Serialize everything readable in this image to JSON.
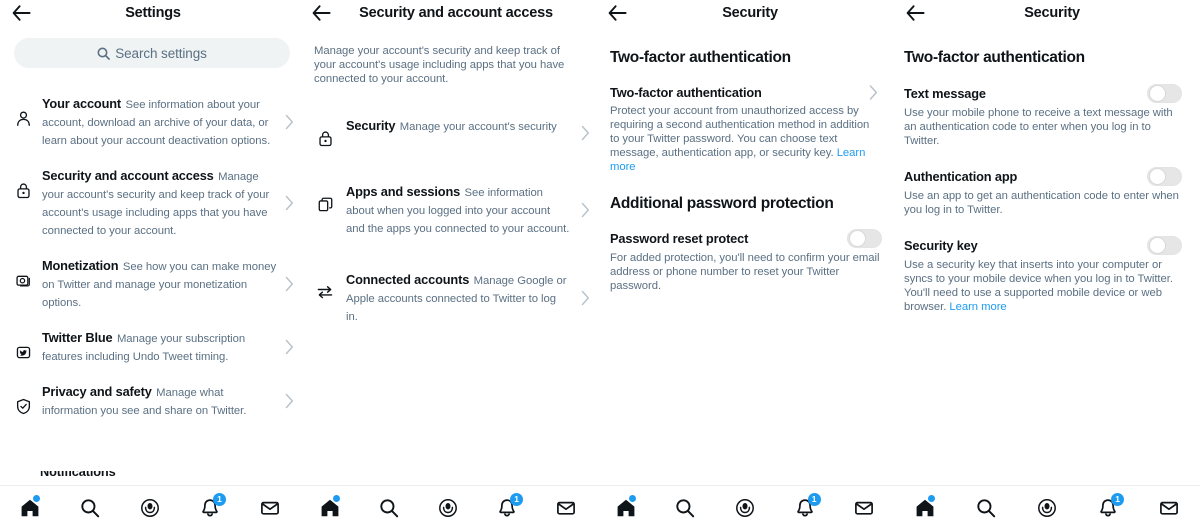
{
  "theme": {
    "accent": "#1d9bf0",
    "text": "#0f1419",
    "muted": "#5b7083",
    "search_bg": "#eff3f4"
  },
  "panels": [
    {
      "id": "settings",
      "title": "Settings",
      "back_icon": "arrow-left-icon",
      "search": {
        "placeholder": "Search settings",
        "icon": "search-icon"
      },
      "rows": [
        {
          "icon": "person-icon",
          "title": "Your account",
          "desc": "See information about your account, download an archive of your data, or learn about your account deactivation options."
        },
        {
          "icon": "lock-icon",
          "title": "Security and account access",
          "desc": "Manage your account's security and keep track of your account's usage including apps that you have connected to your account."
        },
        {
          "icon": "monetization-icon",
          "title": "Monetization",
          "desc": "See how you can make money on Twitter and manage your monetization options."
        },
        {
          "icon": "twitter-blue-badge-icon",
          "title": "Twitter Blue",
          "desc": "Manage your subscription features including Undo Tweet timing."
        },
        {
          "icon": "shield-check-icon",
          "title": "Privacy and safety",
          "desc": "Manage what information you see and share on Twitter."
        }
      ],
      "clipped_row_title": "Notifications"
    },
    {
      "id": "security-and-account-access",
      "title": "Security and account access",
      "back_icon": "arrow-left-icon",
      "intro": "Manage your account's security and keep track of your account's usage including apps that you have connected to your account.",
      "rows": [
        {
          "icon": "lock-icon",
          "title": "Security",
          "desc": "Manage your account's security"
        },
        {
          "icon": "apps-stack-icon",
          "title": "Apps and sessions",
          "desc": "See information about when you logged into your account and the apps you connected to your account."
        },
        {
          "icon": "connected-accounts-icon",
          "title": "Connected accounts",
          "desc": "Manage Google or Apple accounts connected to Twitter to log in."
        }
      ]
    },
    {
      "id": "security-2fa-overview",
      "title": "Security",
      "back_icon": "arrow-left-icon",
      "heading": "Two-factor authentication",
      "blocks": [
        {
          "title": "Two-factor authentication",
          "desc": "Protect your account from unauthorized access by requiring a second authentication method in addition to your Twitter password. You can choose text message, authentication app, or security key.",
          "link": "Learn more",
          "control": "chevron-right"
        }
      ],
      "heading2": "Additional password protection",
      "blocks2": [
        {
          "title": "Password reset protect",
          "desc": "For added protection, you'll need to confirm your email address or phone number to reset your Twitter password.",
          "control": "toggle",
          "toggle_on": false
        }
      ]
    },
    {
      "id": "security-2fa-methods",
      "title": "Security",
      "back_icon": "arrow-left-icon",
      "heading": "Two-factor authentication",
      "blocks": [
        {
          "title": "Text message",
          "desc": "Use your mobile phone to receive a text message with an authentication code to enter when you log in to Twitter.",
          "control": "toggle",
          "toggle_on": false
        },
        {
          "title": "Authentication app",
          "desc": "Use an app to get an authentication code to enter when you log in to Twitter.",
          "control": "toggle",
          "toggle_on": false
        },
        {
          "title": "Security key",
          "desc": "Use a security key that inserts into your computer or syncs to your mobile device when you log in to Twitter. You'll need to use a supported mobile device or web browser.",
          "link": "Learn more",
          "control": "toggle",
          "toggle_on": false
        }
      ]
    }
  ],
  "bottom_nav": {
    "items": [
      {
        "icon": "home-icon",
        "badge_type": "dot",
        "badge": ""
      },
      {
        "icon": "search-icon",
        "badge_type": "none",
        "badge": ""
      },
      {
        "icon": "spaces-icon",
        "badge_type": "none",
        "badge": ""
      },
      {
        "icon": "bell-icon",
        "badge_type": "count",
        "badge": "1"
      },
      {
        "icon": "envelope-icon",
        "badge_type": "none",
        "badge": ""
      }
    ]
  }
}
